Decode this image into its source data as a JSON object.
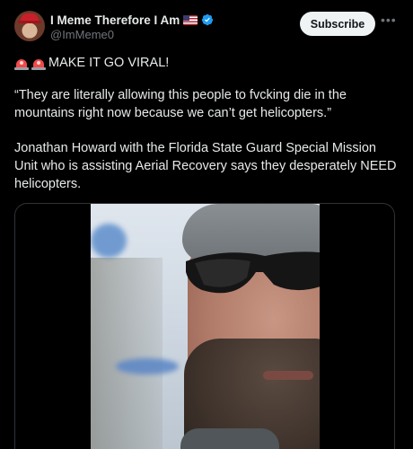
{
  "author": {
    "display_name": "I Meme Therefore I Am",
    "handle": "@ImMeme0",
    "verified": true,
    "flag": "US-flag-icon"
  },
  "actions": {
    "subscribe_label": "Subscribe",
    "more_icon": "more-horizontal-icon"
  },
  "post": {
    "headline": "MAKE IT GO VIRAL!",
    "headline_icons": [
      "siren-icon",
      "siren-icon"
    ],
    "quote": "“They are literally allowing this people to fvcking die in the mountains right now because we can’t get helicopters.”",
    "body": "Jonathan Howard with the Florida State Guard Special Mission Unit who is assisting Aerial Recovery says they desperately NEED helicopters."
  },
  "media": {
    "type": "video",
    "description_icon": "video-thumbnail"
  },
  "colors": {
    "background": "#000000",
    "text_primary": "#e7e9ea",
    "text_secondary": "#71767b",
    "verified_blue": "#1d9bf0",
    "subscribe_bg": "#eff3f4",
    "border": "#2f3336"
  }
}
